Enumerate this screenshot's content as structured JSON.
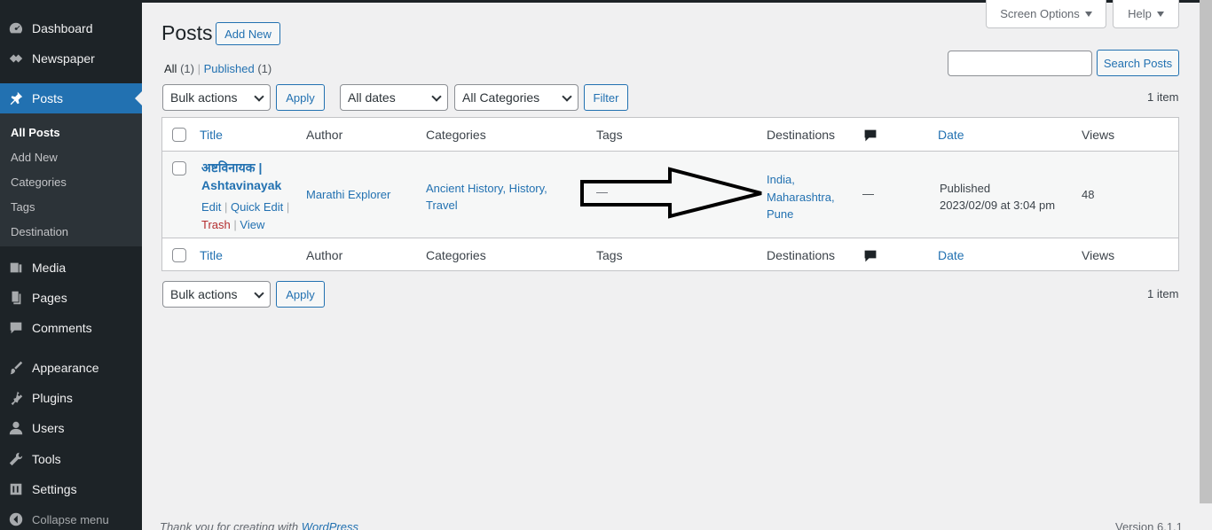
{
  "sidebar": {
    "items": [
      {
        "label": "Dashboard",
        "icon": "dashboard-icon"
      },
      {
        "label": "Newspaper",
        "icon": "newspaper-icon"
      },
      {
        "label": "Posts",
        "icon": "pin-icon"
      },
      {
        "label": "Media",
        "icon": "media-icon"
      },
      {
        "label": "Pages",
        "icon": "pages-icon"
      },
      {
        "label": "Comments",
        "icon": "comments-icon"
      },
      {
        "label": "Appearance",
        "icon": "brush-icon"
      },
      {
        "label": "Plugins",
        "icon": "plug-icon"
      },
      {
        "label": "Users",
        "icon": "users-icon"
      },
      {
        "label": "Tools",
        "icon": "wrench-icon"
      },
      {
        "label": "Settings",
        "icon": "settings-icon"
      }
    ],
    "submenu": [
      "All Posts",
      "Add New",
      "Categories",
      "Tags",
      "Destination"
    ],
    "collapse": "Collapse menu"
  },
  "header": {
    "title": "Posts",
    "add_new": "Add New",
    "screen_options": "Screen Options",
    "help": "Help"
  },
  "filters": {
    "all_label": "All",
    "all_count": "(1)",
    "published_label": "Published",
    "published_count": "(1)",
    "divider": "|",
    "bulk_actions": "Bulk actions",
    "apply": "Apply",
    "all_dates": "All dates",
    "all_categories": "All Categories",
    "filter": "Filter",
    "search_placeholder": "",
    "search_button": "Search Posts",
    "items_count": "1 item"
  },
  "table": {
    "columns": {
      "title": "Title",
      "author": "Author",
      "categories": "Categories",
      "tags": "Tags",
      "destinations": "Destinations",
      "date": "Date",
      "views": "Views"
    },
    "row": {
      "title_line1": "अष्टविनायक |",
      "title_line2": "Ashtavinayak",
      "edit": "Edit",
      "quick_edit": "Quick Edit",
      "trash": "Trash",
      "view": "View",
      "action_sep": "|",
      "author": "Marathi Explorer",
      "categories_line1": "Ancient History, History,",
      "categories_line2": "Travel",
      "tags": "—",
      "destinations": [
        "India,",
        "Maharashtra,",
        "Pune"
      ],
      "comments": "—",
      "date_status": "Published",
      "date_value": "2023/02/09 at 3:04 pm",
      "views": "48"
    }
  },
  "footer": {
    "thanks_prefix": "Thank you for creating with",
    "thanks_link": "WordPress",
    "version": "Version 6.1.1"
  },
  "colors": {
    "sidebar_bg": "#1d2327",
    "accent": "#2271b1",
    "page_bg": "#f0f0f1"
  }
}
